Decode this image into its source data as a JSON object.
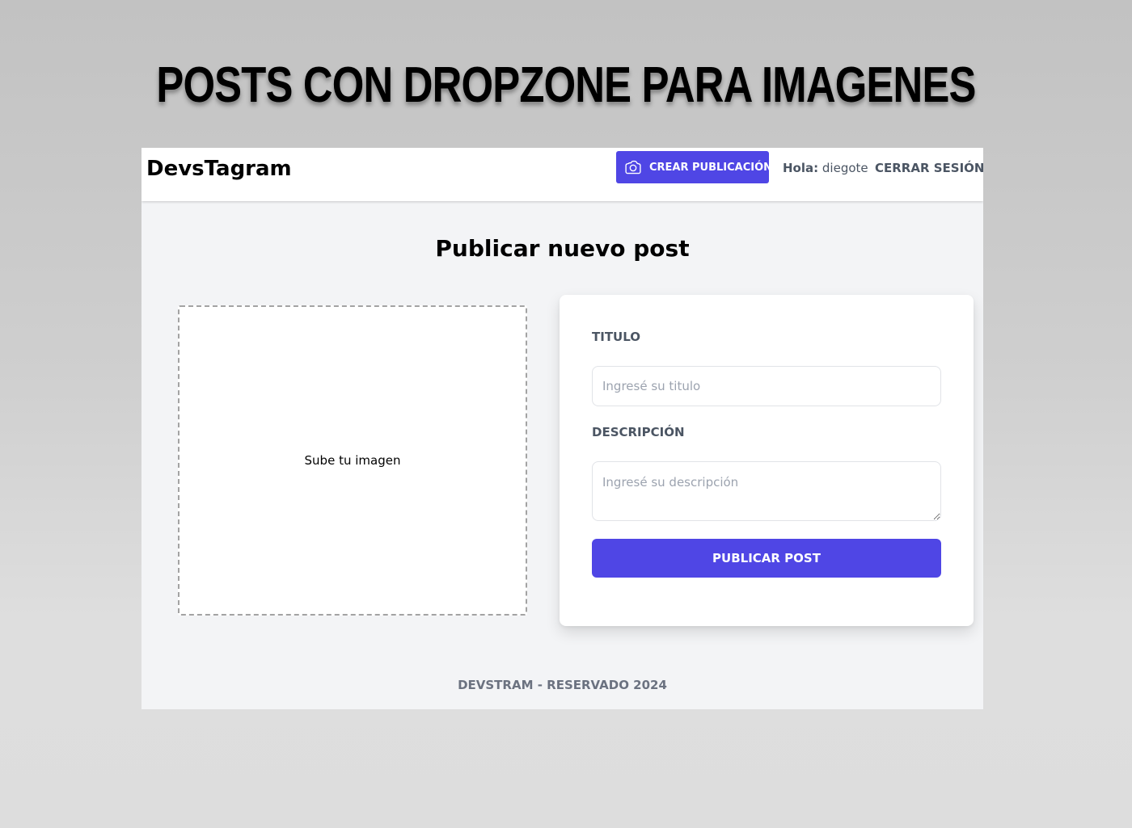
{
  "banner": {
    "title": "POSTS CON DROPZONE PARA IMAGENES"
  },
  "app": {
    "brand": "DevsTagram",
    "header": {
      "create_label": "CREAR PUBLICACIÓN",
      "create_icon": "camera-icon",
      "greeting_prefix": "Hola:",
      "username": "diegote",
      "logout_label": "CERRAR SESIÓN"
    },
    "page_title": "Publicar nuevo post",
    "dropzone": {
      "text": "Sube tu imagen"
    },
    "form": {
      "title_label": "TITULO",
      "title_value": "",
      "title_placeholder": "Ingresé su titulo",
      "description_label": "DESCRIPCIÓN",
      "description_value": "",
      "description_placeholder": "Ingresé su descripción",
      "submit_label": "PUBLICAR POST"
    },
    "footer": "DEVSTRAM - RESERVADO 2024"
  },
  "colors": {
    "accent": "#4f46e5",
    "text_muted": "#4b5563",
    "page_bg": "#f3f4f6"
  }
}
